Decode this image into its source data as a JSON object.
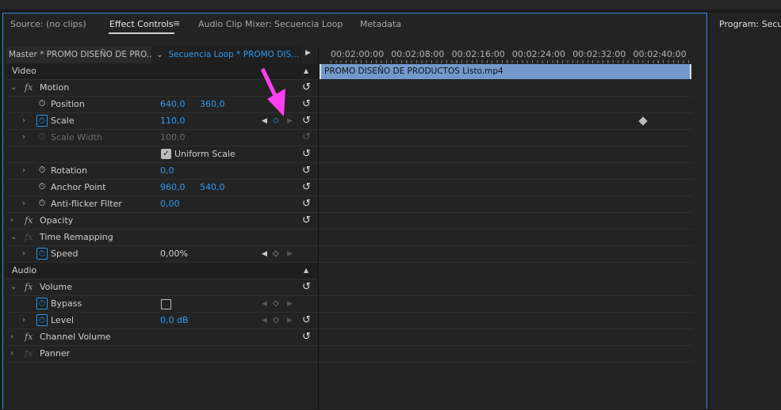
{
  "tabs": [
    {
      "label": "Source: (no clips)",
      "active": false
    },
    {
      "label": "Effect Controls",
      "active": true
    },
    {
      "label": "Audio Clip Mixer: Secuencia Loop",
      "active": false
    },
    {
      "label": "Metadata",
      "active": false
    }
  ],
  "menu_icon": "hamburger-icon",
  "program_tab": "Program: Secuen",
  "clip_header": {
    "master": "Master * PROMO DISEÑO DE PRO...",
    "sequence": "Secuencia Loop * PROMO DIS..."
  },
  "timeline": {
    "ticks": [
      "00:02:00:00",
      "00:02:08:00",
      "00:02:16:00",
      "00:02:24:00",
      "00:02:32:00",
      "00:02:40:00"
    ],
    "clip_name": "PROMO DISEÑO DE PRODUCTOS Listo.mp4",
    "clip_color": "#7399cc",
    "keyframe_at": "00:02:38:00"
  },
  "accent": "#2f9bf0",
  "annotation_color": "#ff3ff0",
  "rows": [
    {
      "type": "section",
      "label": "Video"
    },
    {
      "type": "effect",
      "label": "Motion",
      "twirl": "open",
      "reset": true
    },
    {
      "type": "prop",
      "label": "Position",
      "v1": "640,0",
      "v2": "360,0",
      "reset": true
    },
    {
      "type": "prop",
      "label": "Scale",
      "v1": "110,0",
      "twirl": "closed",
      "animated": true,
      "keys": "active",
      "reset": true
    },
    {
      "type": "prop",
      "label": "Scale Width",
      "v1": "100,0",
      "twirl": "closed",
      "disabled": true,
      "reset": true
    },
    {
      "type": "check",
      "label": "Uniform Scale",
      "checked": true,
      "reset": true
    },
    {
      "type": "prop",
      "label": "Rotation",
      "v1": "0,0",
      "twirl": "closed",
      "reset": true
    },
    {
      "type": "prop",
      "label": "Anchor Point",
      "v1": "960,0",
      "v2": "540,0",
      "reset": true
    },
    {
      "type": "prop",
      "label": "Anti-flicker Filter",
      "v1": "0,00",
      "twirl": "closed",
      "reset": true
    },
    {
      "type": "effect",
      "label": "Opacity",
      "twirl": "closed",
      "reset": true
    },
    {
      "type": "effect",
      "label": "Time Remapping",
      "twirl": "open",
      "fxdim": true
    },
    {
      "type": "prop",
      "label": "Speed",
      "v1": "0,00%",
      "white": true,
      "twirl": "closed",
      "animated": true,
      "keys": "normal"
    },
    {
      "type": "section",
      "label": "Audio"
    },
    {
      "type": "effect",
      "label": "Volume",
      "twirl": "open",
      "reset": true
    },
    {
      "type": "prop",
      "label": "Bypass",
      "checkbox": true,
      "animated": true,
      "keys": "dim"
    },
    {
      "type": "prop",
      "label": "Level",
      "v1": "0,0 dB",
      "twirl": "closed",
      "animated": true,
      "keys": "dim",
      "reset": true
    },
    {
      "type": "effect",
      "label": "Channel Volume",
      "twirl": "closed",
      "reset": true
    },
    {
      "type": "effect",
      "label": "Panner",
      "twirl": "closed",
      "fxdim": true
    }
  ]
}
